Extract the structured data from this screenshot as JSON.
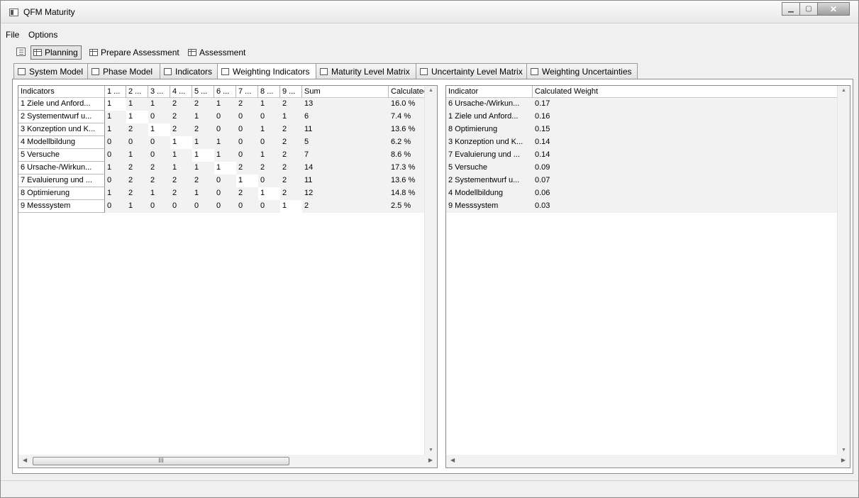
{
  "window": {
    "title": "QFM Maturity"
  },
  "menu": [
    "File",
    "Options"
  ],
  "toolbar": {
    "tabs": [
      {
        "label": "Planning",
        "active": true
      },
      {
        "label": "Prepare Assessment",
        "active": false
      },
      {
        "label": "Assessment",
        "active": false
      }
    ]
  },
  "tabs": [
    {
      "label": "System Model",
      "active": false
    },
    {
      "label": "Phase Model",
      "active": false
    },
    {
      "label": "Indicators",
      "active": false
    },
    {
      "label": "Weighting Indicators",
      "active": true
    },
    {
      "label": "Maturity Level Matrix",
      "active": false
    },
    {
      "label": "Uncertainty Level Matrix",
      "active": false
    },
    {
      "label": "Weighting Uncertainties",
      "active": false
    }
  ],
  "matrix": {
    "columns": [
      "Indicators",
      "1 ...",
      "2 ...",
      "3 ...",
      "4 ...",
      "5 ...",
      "6 ...",
      "7 ...",
      "8 ...",
      "9 ...",
      "Sum",
      "Calculated"
    ],
    "rows": [
      {
        "name": "1 Ziele und Anford...",
        "values": [
          "1",
          "1",
          "1",
          "2",
          "2",
          "1",
          "2",
          "1",
          "2"
        ],
        "sum": "13",
        "calc": "16.0 %"
      },
      {
        "name": "2 Systementwurf u...",
        "values": [
          "1",
          "1",
          "0",
          "2",
          "1",
          "0",
          "0",
          "0",
          "1"
        ],
        "sum": "6",
        "calc": "7.4 %"
      },
      {
        "name": "3 Konzeption und K...",
        "values": [
          "1",
          "2",
          "1",
          "2",
          "2",
          "0",
          "0",
          "1",
          "2"
        ],
        "sum": "11",
        "calc": "13.6 %"
      },
      {
        "name": "4 Modellbildung",
        "values": [
          "0",
          "0",
          "0",
          "1",
          "1",
          "1",
          "0",
          "0",
          "2"
        ],
        "sum": "5",
        "calc": "6.2 %"
      },
      {
        "name": "5 Versuche",
        "values": [
          "0",
          "1",
          "0",
          "1",
          "1",
          "1",
          "0",
          "1",
          "2"
        ],
        "sum": "7",
        "calc": "8.6 %"
      },
      {
        "name": "6 Ursache-/Wirkun...",
        "values": [
          "1",
          "2",
          "2",
          "1",
          "1",
          "1",
          "2",
          "2",
          "2"
        ],
        "sum": "14",
        "calc": "17.3 %"
      },
      {
        "name": "7 Evaluierung und ...",
        "values": [
          "0",
          "2",
          "2",
          "2",
          "2",
          "0",
          "1",
          "0",
          "2"
        ],
        "sum": "11",
        "calc": "13.6 %"
      },
      {
        "name": "8 Optimierung",
        "values": [
          "1",
          "2",
          "1",
          "2",
          "1",
          "0",
          "2",
          "1",
          "2"
        ],
        "sum": "12",
        "calc": "14.8 %"
      },
      {
        "name": "9 Messsystem",
        "values": [
          "0",
          "1",
          "0",
          "0",
          "0",
          "0",
          "0",
          "0",
          "1"
        ],
        "sum": "2",
        "calc": "2.5 %"
      }
    ]
  },
  "weights": {
    "columns": [
      "Indicator",
      "Calculated Weight"
    ],
    "rows": [
      {
        "name": "6 Ursache-/Wirkun...",
        "weight": "0.17"
      },
      {
        "name": "1 Ziele und Anford...",
        "weight": "0.16"
      },
      {
        "name": "8 Optimierung",
        "weight": "0.15"
      },
      {
        "name": "3 Konzeption und K...",
        "weight": "0.14"
      },
      {
        "name": "7 Evaluierung und ...",
        "weight": "0.14"
      },
      {
        "name": "5 Versuche",
        "weight": "0.09"
      },
      {
        "name": "2 Systementwurf u...",
        "weight": "0.07"
      },
      {
        "name": "4 Modellbildung",
        "weight": "0.06"
      },
      {
        "name": "9 Messsystem",
        "weight": "0.03"
      }
    ]
  }
}
